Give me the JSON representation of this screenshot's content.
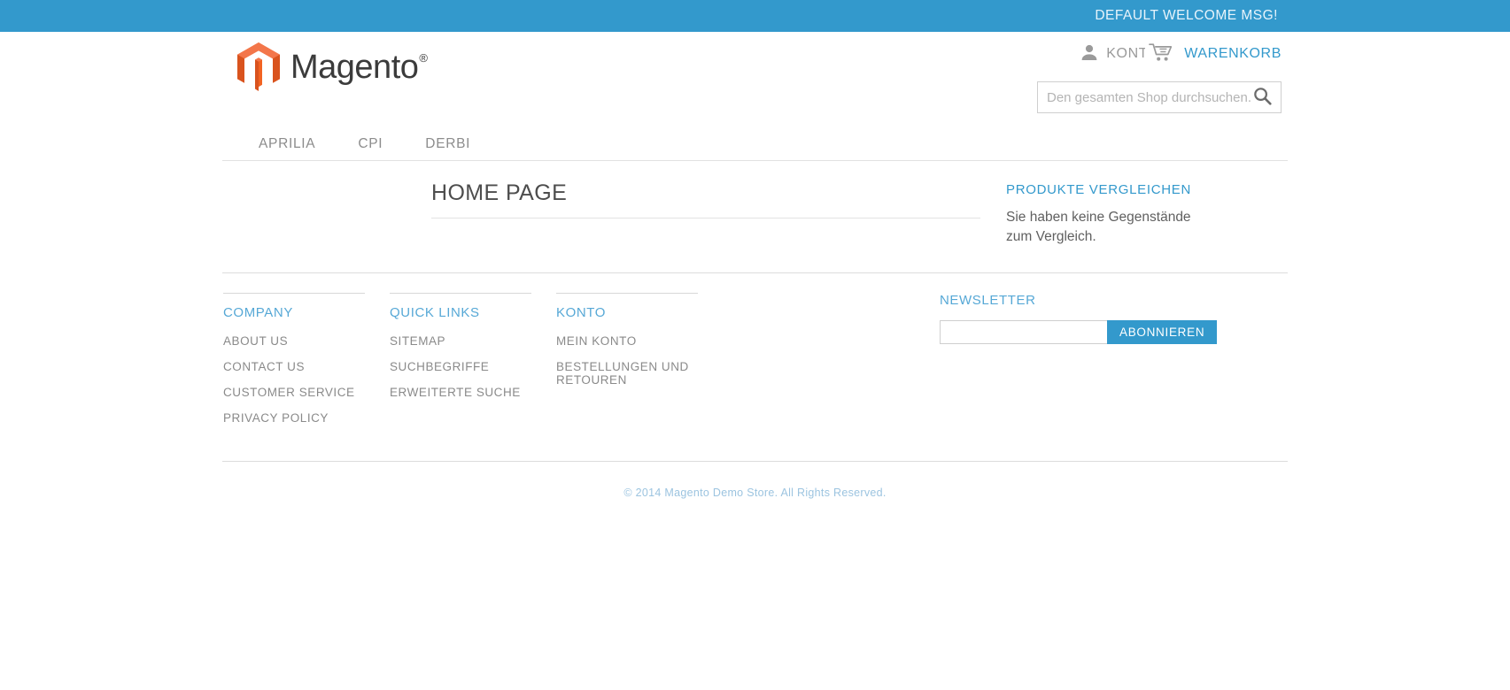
{
  "topbar": {
    "welcome_message": "DEFAULT WELCOME MSG!",
    "background_color": "#3399cc"
  },
  "header": {
    "logo": {
      "icon": "magento-logo-icon",
      "wordmark": "Magento",
      "trademark": "®",
      "brand_color": "#f26322"
    },
    "account_link": {
      "icon": "user-icon",
      "label": "KONTO",
      "visible_label": "KON"
    },
    "cart_link": {
      "icon": "shopping-cart-icon",
      "label": "WARENKORB",
      "color": "#3399cc"
    },
    "search": {
      "placeholder": "Den gesamten Shop durchsuchen...",
      "value": "",
      "icon": "search-icon"
    }
  },
  "nav": {
    "items": [
      {
        "label": "APRILIA"
      },
      {
        "label": "CPI"
      },
      {
        "label": "DERBI"
      }
    ]
  },
  "main": {
    "page_title": "HOME PAGE",
    "compare_block": {
      "title": "PRODUKTE VERGLEICHEN",
      "empty_text": "Sie haben keine Gegenstände zum Vergleich."
    }
  },
  "footer": {
    "columns": [
      {
        "heading": "COMPANY",
        "links": [
          {
            "label": "ABOUT US"
          },
          {
            "label": "CONTACT US"
          },
          {
            "label": "CUSTOMER SERVICE"
          },
          {
            "label": "PRIVACY POLICY"
          }
        ]
      },
      {
        "heading": "QUICK LINKS",
        "links": [
          {
            "label": "SITEMAP"
          },
          {
            "label": "SUCHBEGRIFFE"
          },
          {
            "label": "ERWEITERTE SUCHE"
          }
        ]
      },
      {
        "heading": "KONTO",
        "links": [
          {
            "label": "MEIN KONTO"
          },
          {
            "label": "BESTELLUNGEN UND RETOUREN"
          }
        ]
      }
    ],
    "newsletter": {
      "heading": "NEWSLETTER",
      "input_value": "",
      "input_placeholder": "",
      "button_label": "ABONNIEREN",
      "button_color": "#3399cc"
    },
    "copyright": "© 2014 Magento Demo Store. All Rights Reserved."
  }
}
